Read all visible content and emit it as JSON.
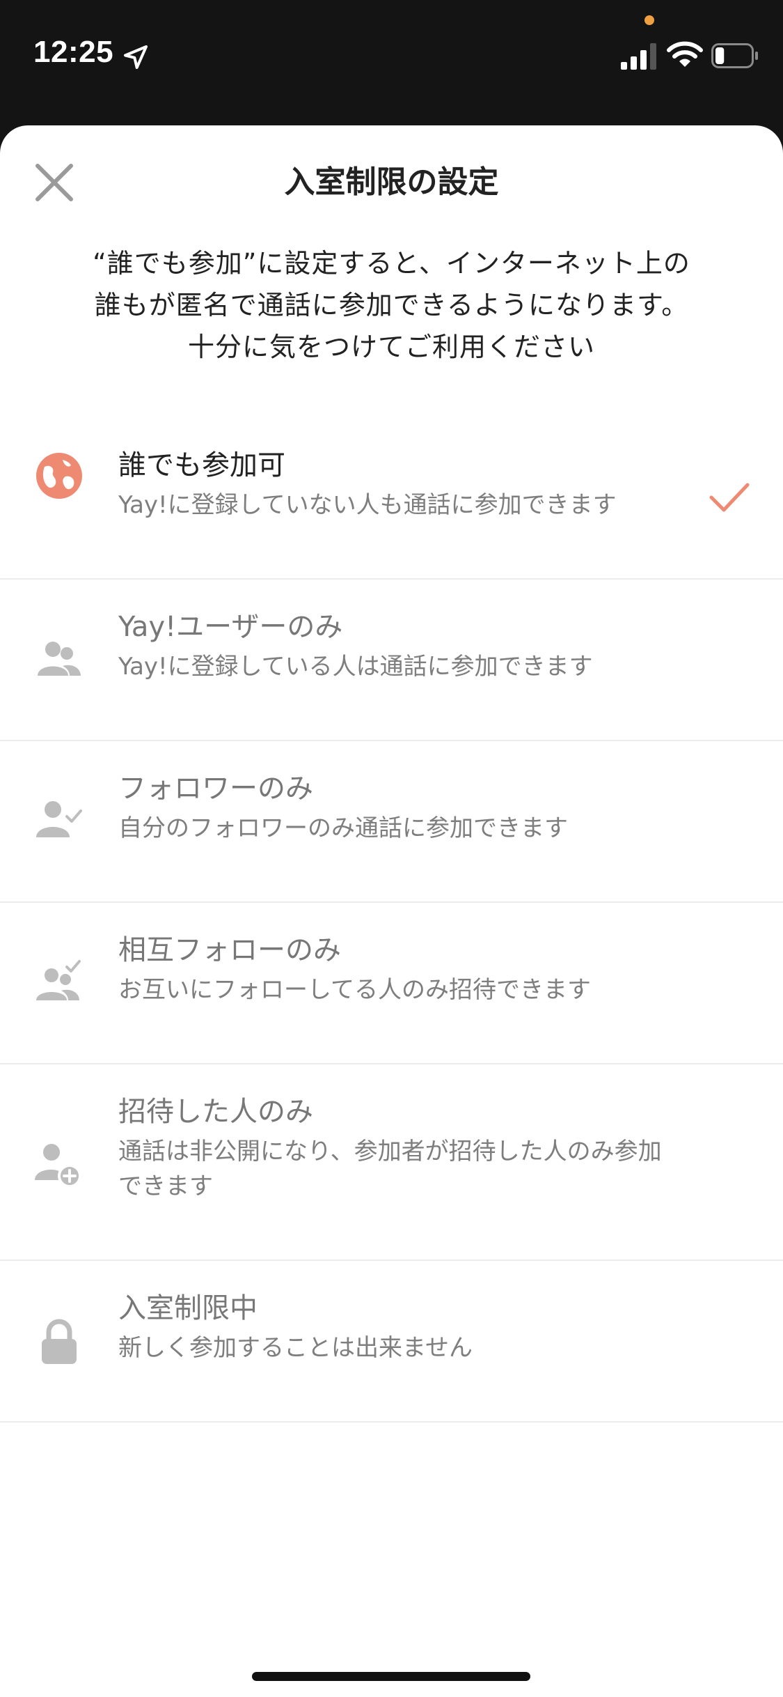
{
  "status": {
    "time": "12:25",
    "battery_level": 0.25
  },
  "sheet": {
    "title": "入室制限の設定",
    "notice_lines": [
      "“誰でも参加”に設定すると、インターネット上の",
      "誰もが匿名で通話に参加できるようになります。",
      "十分に気をつけてご利用ください"
    ]
  },
  "options": [
    {
      "title": "誰でも参加可",
      "description": "Yay!に登録していない人も通話に参加できます",
      "icon": "globe-icon",
      "selected": true
    },
    {
      "title": "Yay!ユーザーのみ",
      "description": "Yay!に登録している人は通話に参加できます",
      "icon": "users-icon",
      "selected": false
    },
    {
      "title": "フォロワーのみ",
      "description": "自分のフォロワーのみ通話に参加できます",
      "icon": "user-check-icon",
      "selected": false
    },
    {
      "title": "相互フォローのみ",
      "description": "お互いにフォローしてる人のみ招待できます",
      "icon": "users-check-icon",
      "selected": false
    },
    {
      "title": "招待した人のみ",
      "description": "通話は非公開になり、参加者が招待した人のみ参加できます",
      "icon": "user-plus-icon",
      "selected": false
    },
    {
      "title": "入室制限中",
      "description": "新しく参加することは出来ません",
      "icon": "lock-icon",
      "selected": false
    }
  ],
  "colors": {
    "accent": "#EE8A72",
    "icon_gray": "#BDBDBD"
  }
}
